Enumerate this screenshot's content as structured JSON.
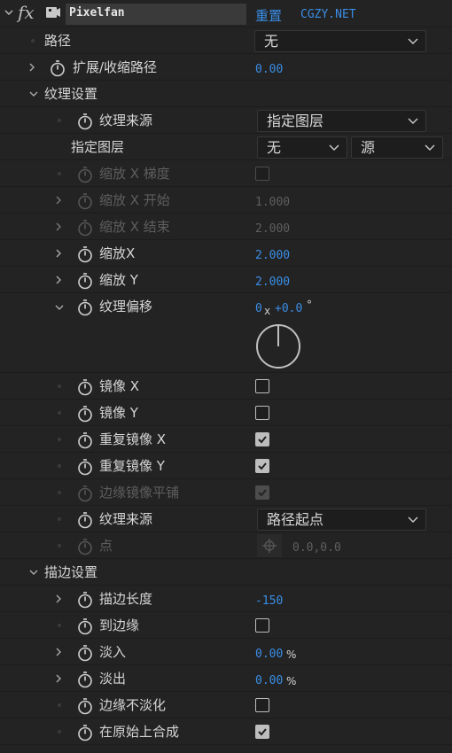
{
  "header": {
    "fx": "fx",
    "effect_name": "Pixelfan",
    "reset_label": "重置",
    "brand": "CGZY.NET"
  },
  "rows": {
    "path": {
      "label": "路径",
      "value": "无"
    },
    "expand": {
      "label": "扩展/收缩路径",
      "value": "0.00"
    },
    "texture_settings": {
      "label": "纹理设置"
    },
    "texture_source": {
      "label": "纹理来源",
      "value": "指定图层"
    },
    "layer": {
      "label": "指定图层",
      "value": "无",
      "value2": "源"
    },
    "scale_x_gradient": {
      "label": "缩放 X 梯度"
    },
    "scale_x_start": {
      "label": "缩放 X 开始",
      "value": "1.000"
    },
    "scale_x_end": {
      "label": "缩放 X 结束",
      "value": "2.000"
    },
    "scale_x": {
      "label": "缩放X",
      "value": "2.000"
    },
    "scale_y": {
      "label": "缩放 Y",
      "value": "2.000"
    },
    "texture_offset": {
      "label": "纹理偏移",
      "rev": "0",
      "x": "x",
      "deg": "+0.0",
      "unit": "°"
    },
    "mirror_x": {
      "label": "镜像 X"
    },
    "mirror_y": {
      "label": "镜像 Y"
    },
    "repeat_mirror_x": {
      "label": "重复镜像 X"
    },
    "repeat_mirror_y": {
      "label": "重复镜像 Y"
    },
    "edge_mirror_tile": {
      "label": "边缘镜像平铺"
    },
    "texture_source2": {
      "label": "纹理来源",
      "value": "路径起点"
    },
    "point": {
      "label": "点",
      "value": "0.0,0.0"
    },
    "stroke_settings": {
      "label": "描边设置"
    },
    "stroke_length": {
      "label": "描边长度",
      "value": "-150"
    },
    "to_edge": {
      "label": "到边缘"
    },
    "fade_in": {
      "label": "淡入",
      "value": "0.00",
      "unit": "%"
    },
    "fade_out": {
      "label": "淡出",
      "value": "0.00",
      "unit": "%"
    },
    "edge_no_fade": {
      "label": "边缘不淡化"
    },
    "composite_on_original": {
      "label": "在原始上合成"
    }
  },
  "checkboxes": {
    "scale_x_gradient": false,
    "mirror_x": false,
    "mirror_y": false,
    "repeat_mirror_x": true,
    "repeat_mirror_y": true,
    "edge_mirror_tile": true,
    "to_edge": false,
    "edge_no_fade": false,
    "composite_on_original": true
  },
  "colors": {
    "accent": "#3a8ee6",
    "background": "#232323",
    "text": "#d6d6d6",
    "disabled": "#5e5e5e"
  }
}
